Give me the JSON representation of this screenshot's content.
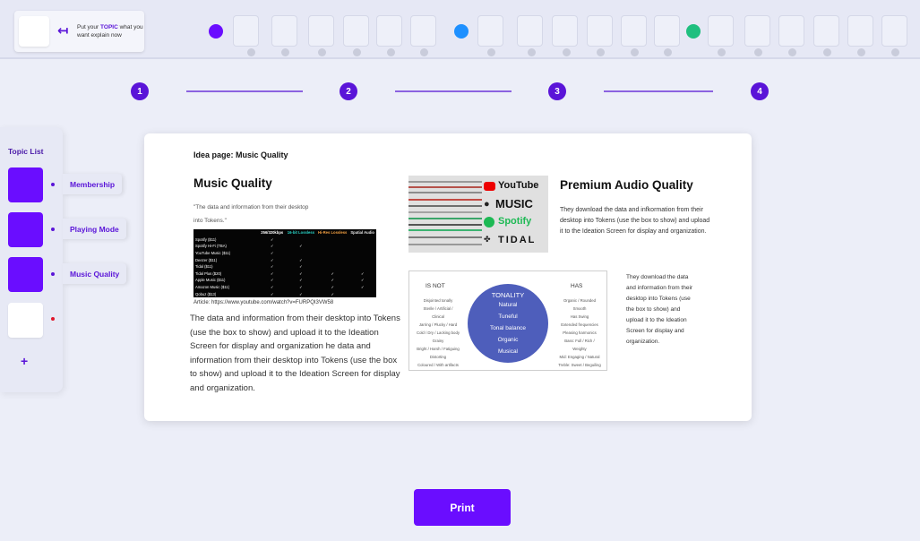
{
  "topbar": {
    "topic_prompt_pre": "Put your",
    "topic_prompt_key": "TOPIC",
    "topic_prompt_post": "what you want explain now",
    "group_colors": [
      "#6a0dff",
      "#1e90ff",
      "#1fbf7f"
    ]
  },
  "steps": [
    "1",
    "2",
    "3",
    "4"
  ],
  "sidebar": {
    "title": "Topic List",
    "items": [
      {
        "label": "Membership"
      },
      {
        "label": "Playing Mode"
      },
      {
        "label": "Music Quality"
      }
    ],
    "add_label": "+"
  },
  "card": {
    "page_label": "Idea page: Music Quality",
    "left": {
      "heading": "Music Quality",
      "quote": "\"The data and information from their desktop into Tokens.\"",
      "article": "Article: https://www.youtube.com/watch?v=FURPQI3VW58",
      "body": "The data and information from their desktop into Tokens (use the box to show) and upload it to the Ideation Screen for display and organization he data and information from their desktop into Tokens (use the box to show) and upload it to the Ideation Screen for display and organization."
    },
    "table": {
      "headers": [
        "",
        "256/320kbps",
        "16-bit Lossless",
        "Hi-Res Lossless",
        "Spatial Audio"
      ],
      "rows": [
        [
          "Spotify ($11)",
          "✓",
          "",
          "",
          ""
        ],
        [
          "Spotify Hi-Fi (TBA)",
          "✓",
          "✓",
          "",
          ""
        ],
        [
          "YouTube Music ($11)",
          "✓",
          "",
          "",
          ""
        ],
        [
          "Deezer ($11)",
          "✓",
          "✓",
          "",
          ""
        ],
        [
          "Tidal ($11)",
          "✓",
          "✓",
          "",
          ""
        ],
        [
          "Tidal Plus ($20)",
          "✓",
          "✓",
          "✓",
          "✓"
        ],
        [
          "Apple Music ($11)",
          "✓",
          "✓",
          "✓",
          "✓"
        ],
        [
          "Amazon Music ($11)",
          "✓",
          "✓",
          "✓",
          "✓"
        ],
        [
          "Qobuz ($13)",
          "✓",
          "✓",
          "✓",
          ""
        ]
      ]
    },
    "logos": [
      "YouTube",
      "MUSIC",
      "Spotify",
      "TIDAL"
    ],
    "right": {
      "heading": "Premium Audio Quality",
      "desc": "They download the data and infkormation from their desktop into Tokens (use the box to show) and upload it to the Ideation Screen for display and organization.",
      "desc2": "They download the data and information from their desktop into Tokens (use the box to show) and upload it to the Ideation Screen for display and organization."
    },
    "tonality": {
      "is_not_title": "IS NOT",
      "has_title": "HAS",
      "center_title": "TONALITY",
      "center_items": [
        "Natural",
        "Tuneful",
        "Tonal balance",
        "Organic",
        "Musical"
      ],
      "is_not": [
        "Disjointed tonally",
        "Sterile / Artificial /",
        "Clinical",
        "Jarring / Plucky / Hard",
        "Cold / Dry / Lacking body",
        "Grainy",
        "Bright / Harsh / Fatiguing",
        "Distorting",
        "Coloured / With artifacts"
      ],
      "has": [
        "Organic / Rounded",
        "Smooth",
        "Has Swing",
        "Extended frequencies",
        "Pleasing harmonics",
        "Bass: Full / Rich /",
        "Weighty",
        "Mid: Engaging / Natural",
        "Treble: Sweet / Beguiling"
      ]
    }
  },
  "print_label": "Print"
}
